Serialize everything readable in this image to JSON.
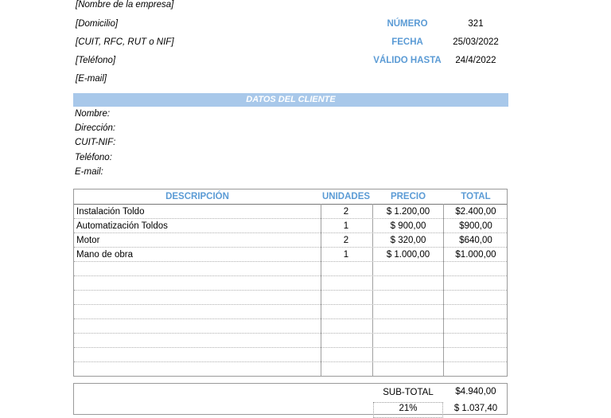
{
  "company": {
    "name": "[Nombre de la empresa]",
    "address": "[Domicilio]",
    "tax_id": "[CUIT, RFC, RUT o NIF]",
    "phone": "[Teléfono]",
    "email": "[E-mail]"
  },
  "meta": {
    "number_label": "NÚMERO",
    "number": "321",
    "date_label": "FECHA",
    "date": "25/03/2022",
    "valid_label": "VÁLIDO HASTA",
    "valid": "24/4/2022"
  },
  "client": {
    "header": "DATOS DEL CLIENTE",
    "name_label": "Nombre:",
    "address_label": "Dirección:",
    "tax_label": "CUIT-NIF:",
    "phone_label": "Teléfono:",
    "email_label": "E-mail:"
  },
  "table": {
    "headers": [
      "DESCRIPCIÓN",
      "UNIDADES",
      "PRECIO",
      "TOTAL"
    ],
    "rows": [
      {
        "desc": "Instalación Toldo",
        "units": "2",
        "price": "$ 1.200,00",
        "total": "$2.400,00"
      },
      {
        "desc": "Automatización Toldos",
        "units": "1",
        "price": "$ 900,00",
        "total": "$900,00"
      },
      {
        "desc": "Motor",
        "units": "2",
        "price": "$ 320,00",
        "total": "$640,00"
      },
      {
        "desc": "Mano de obra",
        "units": "1",
        "price": "$ 1.000,00",
        "total": "$1.000,00"
      }
    ]
  },
  "totals": {
    "subtotal_label": "SUB-TOTAL",
    "subtotal": "$4.940,00",
    "tax_label": "21%",
    "tax": "$ 1.037,40"
  },
  "colors": {
    "accent": "#5b9bd5",
    "header_bar": "#a8c8ea"
  }
}
